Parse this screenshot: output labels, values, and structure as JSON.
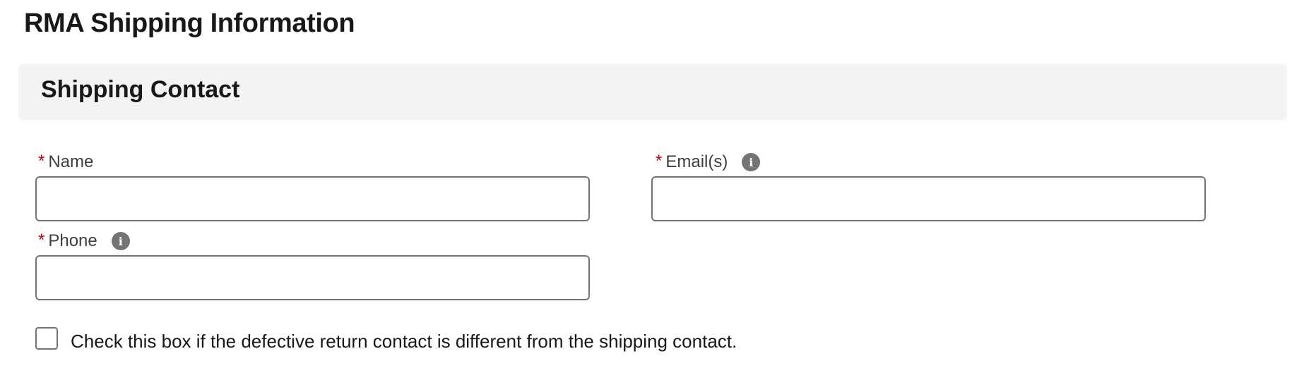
{
  "page": {
    "title": "RMA Shipping Information"
  },
  "section": {
    "title": "Shipping Contact"
  },
  "fields": {
    "name": {
      "required_marker": "*",
      "label": "Name",
      "value": "",
      "placeholder": ""
    },
    "email": {
      "required_marker": "*",
      "label": "Email(s)",
      "value": "",
      "placeholder": "",
      "has_info_icon": true
    },
    "phone": {
      "required_marker": "*",
      "label": "Phone",
      "value": "",
      "placeholder": "",
      "has_info_icon": true
    }
  },
  "icons": {
    "info": "i"
  },
  "checkbox": {
    "label": "Check this box if the defective return contact is different from the shipping contact.",
    "checked": false
  },
  "colors": {
    "required": "#ba0517",
    "section_header_bg": "#f3f3f3",
    "input_border": "#747474",
    "info_icon_bg": "#747474"
  }
}
